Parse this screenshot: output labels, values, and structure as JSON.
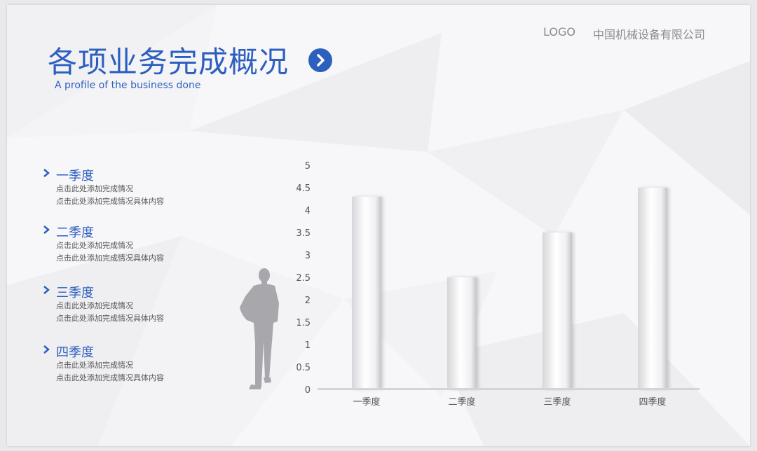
{
  "header": {
    "title": "各项业务完成概况",
    "subtitle": "A profile of the business done",
    "logo": "LOGO",
    "company": "中国机械设备有限公司",
    "accent": "#2d5fbf"
  },
  "items": [
    {
      "title": "一季度",
      "line1": "点击此处添加完成情况",
      "line2": "点击此处添加完成情况具体内容"
    },
    {
      "title": "二季度",
      "line1": "点击此处添加完成情况",
      "line2": "点击此处添加完成情况具体内容"
    },
    {
      "title": "三季度",
      "line1": "点击此处添加完成情况",
      "line2": "点击此处添加完成情况具体内容"
    },
    {
      "title": "四季度",
      "line1": "点击此处添加完成情况",
      "line2": "点击此处添加完成情况具体内容"
    }
  ],
  "chart_data": {
    "type": "bar",
    "categories": [
      "一季度",
      "二季度",
      "三季度",
      "四季度"
    ],
    "values": [
      4.3,
      2.5,
      3.5,
      4.5
    ],
    "ylim": [
      0,
      5
    ],
    "yticks": [
      "0",
      "0.5",
      "1",
      "1.5",
      "2",
      "2.5",
      "3",
      "3.5",
      "4",
      "4.5",
      "5"
    ],
    "title": "",
    "xlabel": "",
    "ylabel": "",
    "grid": false,
    "legend": "none"
  }
}
